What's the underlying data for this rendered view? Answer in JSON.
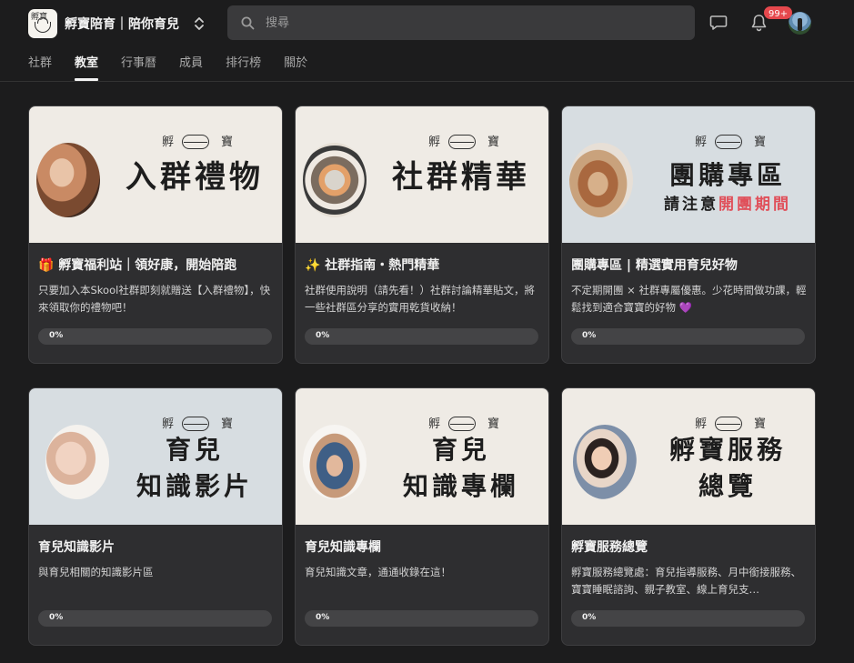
{
  "header": {
    "brand_name": "孵寶陪育｜陪你育兒",
    "logo_text": "孵寶",
    "search_placeholder": "搜尋",
    "notification_count": "99+"
  },
  "tabs": [
    {
      "label": "社群",
      "active": false
    },
    {
      "label": "教室",
      "active": true
    },
    {
      "label": "行事曆",
      "active": false
    },
    {
      "label": "成員",
      "active": false
    },
    {
      "label": "排行榜",
      "active": false
    },
    {
      "label": "關於",
      "active": false
    }
  ],
  "cover_logo": {
    "left": "孵",
    "right": "寶"
  },
  "cards": [
    {
      "cover_bg": "beige",
      "cover_lines": [
        "入群禮物"
      ],
      "cover_style": "big",
      "title": "🎁 孵寶福利站｜領好康，開始陪跑",
      "desc": "只要加入本Skool社群即刻就贈送【入群禮物】，快來領取你的禮物吧！",
      "progress": "0%",
      "progress_value": 0
    },
    {
      "cover_bg": "beige",
      "cover_lines": [
        "社群精華"
      ],
      "cover_style": "big",
      "title": "✨ 社群指南・熱門精華",
      "desc": "社群使用說明（請先看！）社群討論精華貼文，將一些社群區分享的實用乾貨收納！",
      "progress": "0%",
      "progress_value": 0
    },
    {
      "cover_bg": "blue",
      "cover_lines": [
        "團購專區"
      ],
      "cover_sub_prefix": "請注意",
      "cover_sub_highlight": "開團期間",
      "cover_style": "mid",
      "title": "團購專區 | 精選實用育兒好物",
      "desc": "不定期開團 × 社群專屬優惠。少花時間做功課，輕鬆找到適合寶寶的好物 💜",
      "progress": "0%",
      "progress_value": 0
    },
    {
      "cover_bg": "blue",
      "cover_lines": [
        "育兒",
        "知識影片"
      ],
      "cover_style": "mid",
      "title": "育兒知識影片",
      "desc": "與育兒相關的知識影片區",
      "progress": "0%",
      "progress_value": 0
    },
    {
      "cover_bg": "beige",
      "cover_lines": [
        "育兒",
        "知識專欄"
      ],
      "cover_style": "mid",
      "title": "育兒知識專欄",
      "desc": "育兒知識文章，通通收錄在這！",
      "progress": "0%",
      "progress_value": 0
    },
    {
      "cover_bg": "beige",
      "cover_lines": [
        "孵寶服務",
        "總覽"
      ],
      "cover_style": "mid",
      "title": "孵寶服務總覽",
      "desc": "孵寶服務總覽處：育兒指導服務、月中銜接服務、寶寶睡眠諮詢、親子教室、線上育兒支…",
      "progress": "0%",
      "progress_value": 0
    }
  ]
}
